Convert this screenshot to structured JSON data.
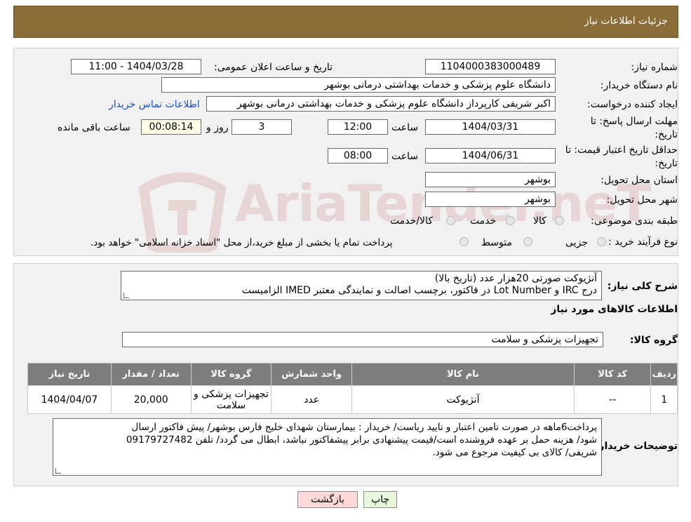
{
  "header": {
    "title": "جزئیات اطلاعات نیاز"
  },
  "form": {
    "need_number_label": "شماره نیاز:",
    "need_number": "1104000383000489",
    "announce_label": "تاریخ و ساعت اعلان عمومی:",
    "announce_value": "1404/03/28 - 11:00",
    "buyer_org_label": "نام دستگاه خریدار:",
    "buyer_org": "دانشگاه علوم پزشکی و خدمات بهداشتی درمانی بوشهر",
    "requester_label": "ایجاد کننده درخواست:",
    "requester": "اکبر شریفی کارپرداز دانشگاه علوم پزشکی و خدمات بهداشتی درمانی بوشهر",
    "contact_link": "اطلاعات تماس خریدار",
    "deadline_label": "مهلت ارسال پاسخ: تا تاریخ:",
    "deadline_date": "1404/03/31",
    "time_label": "ساعت",
    "deadline_time": "12:00",
    "days": "3",
    "days_label": "روز و",
    "remaining": "00:08:14",
    "remaining_label": "ساعت باقی مانده",
    "validity_label": "حداقل تاریخ اعتبار قیمت: تا تاریخ:",
    "validity_date": "1404/06/31",
    "validity_time": "08:00",
    "province_label": "استان محل تحویل:",
    "province": "بوشهر",
    "city_label": "شهر محل تحویل:",
    "city": "بوشهر",
    "category_label": "طبقه بندی موضوعی:",
    "category_options": [
      "کالا",
      "خدمت",
      "کالا/خدمت"
    ],
    "purchase_type_label": "نوع فرآیند خرید :",
    "purchase_options": [
      "جزیی",
      "متوسط"
    ],
    "purchase_note": "پرداخت تمام یا بخشی از مبلغ خرید،از محل \"اسناد خزانه اسلامی\" خواهد بود."
  },
  "description": {
    "label": "شرح کلی نیاز:",
    "line1": "آنژیوکت صورتی 20هزار عدد (تاریخ بالا)",
    "line2": "درج IRC و Lot Number در فاکتور، برچسب اصالت و نمایندگی معتبر IMED الزامیست"
  },
  "goods": {
    "section_title": "اطلاعات کالاهای مورد نیاز",
    "group_label": "گروه کالا:",
    "group_value": "تجهیزات پزشکی و سلامت",
    "columns": [
      "ردیف",
      "کد کالا",
      "نام کالا",
      "واحد شمارش",
      "گروه کالا",
      "تعداد / مقدار",
      "تاریخ نیاز"
    ],
    "rows": [
      [
        "1",
        "--",
        "آنژیوکت",
        "عدد",
        "تجهیزات پزشکی و سلامت",
        "20,000",
        "1404/04/07"
      ]
    ]
  },
  "buyer_notes": {
    "label": "توضیحات خریدار:",
    "line1": "پرداخت6ماهه در صورت تامین اعتبار و تایید ریاست/ خریدار : بیمارستان شهدای خلیج فارس بوشهر/ پیش فاکتور ارسال",
    "line2": "شود/ هزینه حمل بر عهده فروشنده است/قیمت پیشنهادی برابر پیشفاکتور نباشد، ابطال می گردد/ تلفن 09179727482",
    "line3": "شریفی/ کالای بی کیفیت مرجوع می شود."
  },
  "buttons": {
    "print": "چاپ",
    "back": "بازگشت"
  },
  "colors": {
    "header": "#8b6d3a",
    "table_header": "#7d7d7d",
    "back_button": "#ffd9d9",
    "print_button": "#e6f7dc"
  }
}
